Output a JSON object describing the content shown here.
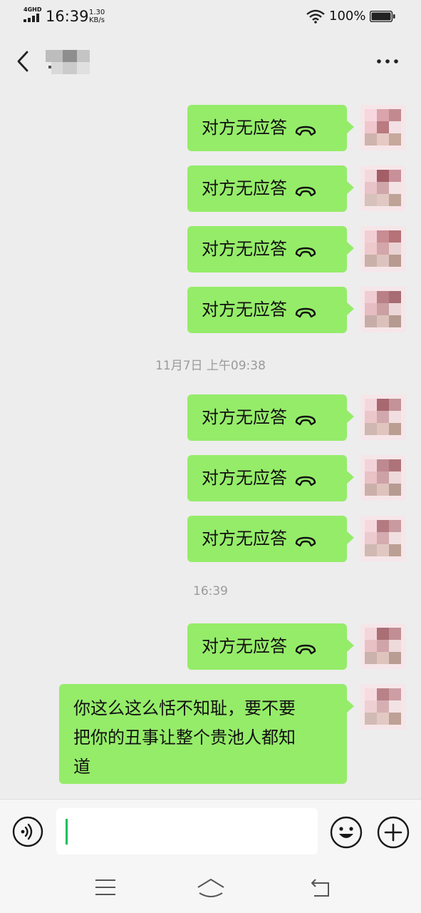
{
  "status_bar": {
    "network": "4GHD",
    "time": "16:39",
    "speed_value": "1.30",
    "speed_unit": "KB/s",
    "battery": "100%"
  },
  "header": {
    "contact_name": "",
    "back_icon": "chevron-left-icon",
    "more_icon": "more-dots-icon"
  },
  "messages": [
    {
      "type": "call",
      "text": "对方无应答",
      "icon": "hangup-phone-icon"
    },
    {
      "type": "call",
      "text": "对方无应答",
      "icon": "hangup-phone-icon"
    },
    {
      "type": "call",
      "text": "对方无应答",
      "icon": "hangup-phone-icon"
    },
    {
      "type": "call",
      "text": "对方无应答",
      "icon": "hangup-phone-icon"
    },
    {
      "type": "time",
      "text": "11月7日 上午09:38"
    },
    {
      "type": "call",
      "text": "对方无应答",
      "icon": "hangup-phone-icon"
    },
    {
      "type": "call",
      "text": "对方无应答",
      "icon": "hangup-phone-icon"
    },
    {
      "type": "call",
      "text": "对方无应答",
      "icon": "hangup-phone-icon"
    },
    {
      "type": "time",
      "text": "16:39"
    },
    {
      "type": "call",
      "text": "对方无应答",
      "icon": "hangup-phone-icon"
    },
    {
      "type": "text",
      "line1": "你这么这么恬不知耻，要不要",
      "line2": "把你的丑事让整个贵池人都知",
      "line3": "道"
    }
  ],
  "input_bar": {
    "value": "",
    "voice_icon": "voice-icon",
    "emoji_icon": "emoji-icon",
    "plus_icon": "plus-icon"
  },
  "nav_bar": {
    "menu_icon": "menu-icon",
    "home_icon": "home-icon",
    "back_icon": "back-icon"
  },
  "colors": {
    "bubble": "#95ec69",
    "background": "#ededed",
    "caret": "#07c160"
  }
}
